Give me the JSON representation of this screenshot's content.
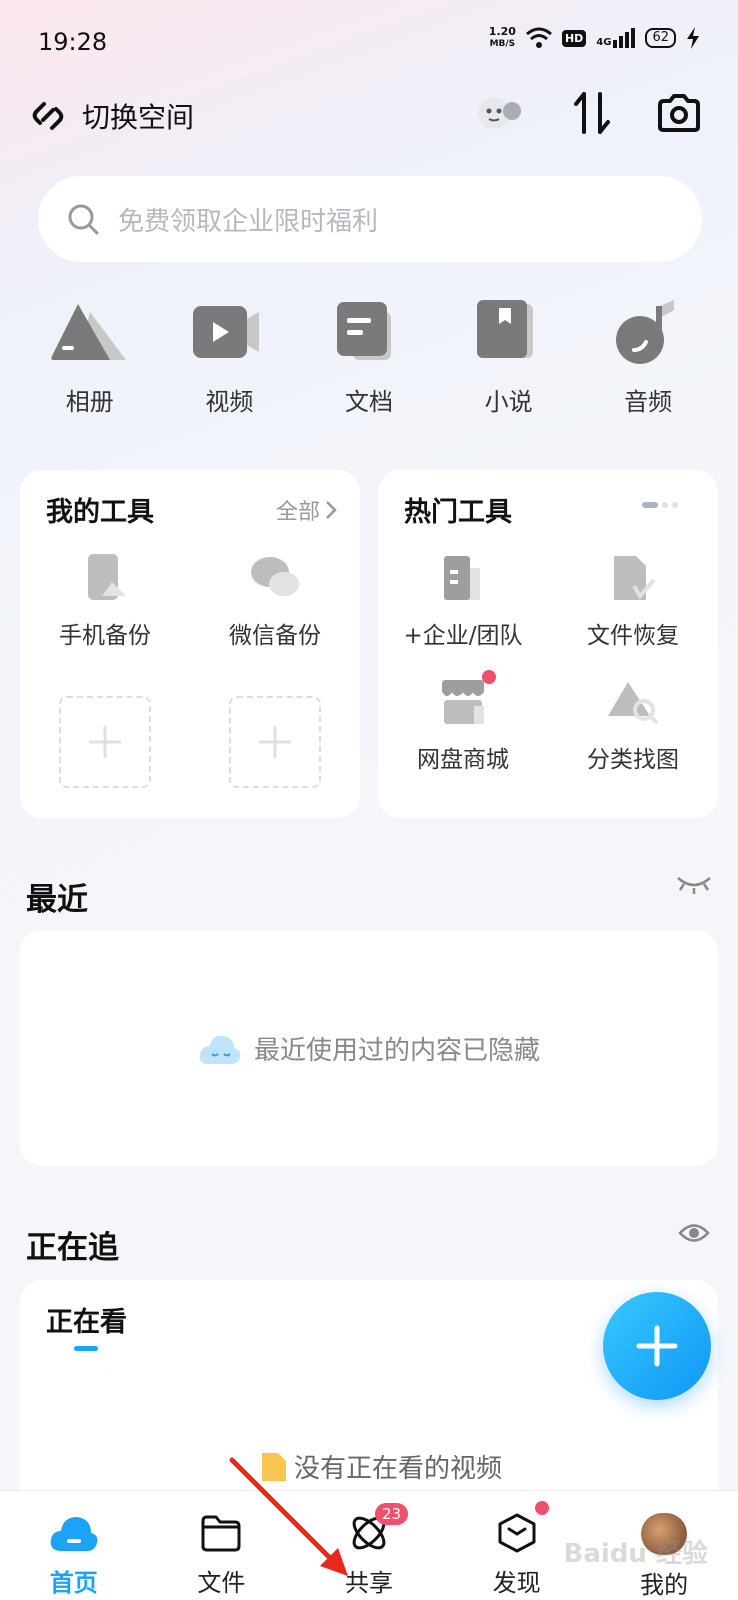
{
  "status_bar": {
    "time": "19:28",
    "net_speed_value": "1.20",
    "net_speed_unit": "MB/S",
    "hd": "HD",
    "network": "4G",
    "battery": "62"
  },
  "header": {
    "switch_space": "切换空间"
  },
  "search": {
    "placeholder": "免费领取企业限时福利"
  },
  "categories": [
    {
      "label": "相册",
      "icon": "mountain-photo-icon"
    },
    {
      "label": "视频",
      "icon": "video-play-icon"
    },
    {
      "label": "文档",
      "icon": "document-icon"
    },
    {
      "label": "小说",
      "icon": "book-icon"
    },
    {
      "label": "音频",
      "icon": "music-note-icon"
    }
  ],
  "my_tools": {
    "title": "我的工具",
    "all": "全部",
    "items": [
      {
        "label": "手机备份",
        "icon": "phone-backup-icon"
      },
      {
        "label": "微信备份",
        "icon": "wechat-backup-icon"
      }
    ]
  },
  "hot_tools": {
    "title": "热门工具",
    "items": [
      {
        "label": "+企业/团队",
        "icon": "enterprise-building-icon"
      },
      {
        "label": "文件恢复",
        "icon": "file-recover-icon"
      },
      {
        "label": "网盘商城",
        "icon": "store-icon"
      },
      {
        "label": "分类找图",
        "icon": "image-search-icon"
      }
    ]
  },
  "recent": {
    "title": "最近",
    "empty_message": "最近使用过的内容已隐藏"
  },
  "following": {
    "title": "正在追",
    "tab": "正在看",
    "empty_message": "没有正在看的视频"
  },
  "bottom_nav": [
    {
      "label": "首页",
      "active": true
    },
    {
      "label": "文件",
      "active": false
    },
    {
      "label": "共享",
      "active": false,
      "badge": "23"
    },
    {
      "label": "发现",
      "active": false
    },
    {
      "label": "我的",
      "active": false
    }
  ],
  "watermark": "Baidu 经验",
  "colors": {
    "accent": "#1aa3f7",
    "badge": "#f0506e",
    "icon_gray": "#8a8a8a",
    "arrow_annotation": "#e8281e"
  }
}
